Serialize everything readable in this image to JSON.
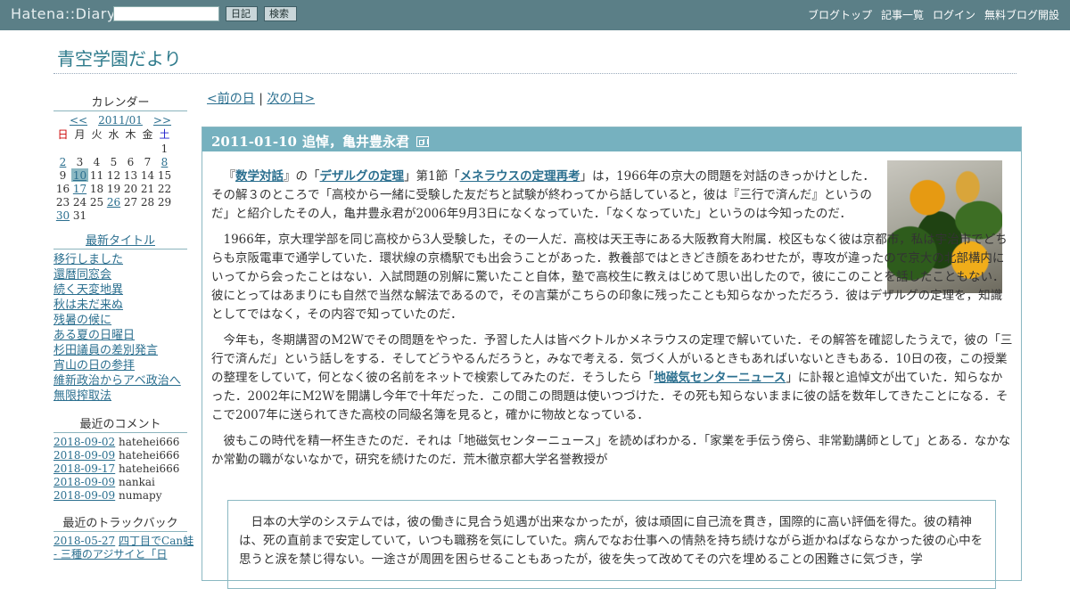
{
  "topbar": {
    "logo": "Hatena::Diary",
    "search_placeholder": "",
    "diary_button": "日記",
    "search_button": "検索",
    "links": [
      "ブログトップ",
      "記事一覧",
      "ログイン",
      "無料ブログ開設"
    ]
  },
  "blog": {
    "title": "青空学園だより"
  },
  "sidebar": {
    "calendar_title": "カレンダー",
    "cal_prev": "<<",
    "cal_month": "2011/01",
    "cal_next": ">>",
    "weekdays": [
      "日",
      "月",
      "火",
      "水",
      "木",
      "金",
      "土"
    ],
    "weeks": [
      [
        "",
        "",
        "",
        "",
        "",
        "",
        "1"
      ],
      [
        "2",
        "3",
        "4",
        "5",
        "6",
        "7",
        "8"
      ],
      [
        "9",
        "10",
        "11",
        "12",
        "13",
        "14",
        "15"
      ],
      [
        "16",
        "17",
        "18",
        "19",
        "20",
        "21",
        "22"
      ],
      [
        "23",
        "24",
        "25",
        "26",
        "27",
        "28",
        "29"
      ],
      [
        "30",
        "31",
        "",
        "",
        "",
        "",
        ""
      ]
    ],
    "linked_days": [
      "2",
      "8",
      "10",
      "17",
      "26",
      "30"
    ],
    "today": "10",
    "recent_titles_heading": "最新タイトル",
    "recent_titles": [
      "移行しました",
      "還暦同窓会",
      "続く天変地異",
      "秋は未だ来ぬ",
      "残暑の候に",
      "ある夏の日曜日",
      "杉田議員の差別発言",
      "宵山の日の参拝",
      "維新政治からアベ政治へ",
      "無限搾取法"
    ],
    "recent_comments_heading": "最近のコメント",
    "recent_comments": [
      {
        "date": "2018-09-02",
        "user": "hatehei666"
      },
      {
        "date": "2018-09-09",
        "user": "hatehei666"
      },
      {
        "date": "2018-09-17",
        "user": "hatehei666"
      },
      {
        "date": "2018-09-09",
        "user": "nankai"
      },
      {
        "date": "2018-09-09",
        "user": "numapy"
      }
    ],
    "recent_trackbacks_heading": "最近のトラックバック",
    "recent_trackbacks": [
      {
        "date": "2018-05-27",
        "title": "四丁目でCan蛙"
      },
      {
        "date": "",
        "title": "- 三種のアジサイと「日"
      }
    ]
  },
  "main": {
    "prev_day": "<前の日",
    "separator": "|",
    "next_day": "次の日>",
    "entry": {
      "date": "2011-01-10",
      "title": "追悼，亀井豊永君",
      "p1": [
        "『",
        "数学対話",
        "』の「",
        "デザルグの定理",
        "」第1節「",
        "メネラウスの定理再考",
        "」は，1966年の京大の問題を対話のきっかけとした．その解３のところで「高校から一緒に受験した友だちと試験が終わってから話していると，彼は『三行で済んだ』というのだ」と紹介したその人，亀井豊永君が2006年9月3日になくなっていた．「なくなっていた」というのは今知ったのだ．"
      ],
      "p2": "1966年，京大理学部を同じ高校から3人受験した，その一人だ．高校は天王寺にある大阪教育大附属．校区もなく彼は京都市，私は宇治市でどちらも京阪電車で通学していた．環状線の京橋駅でも出会うことがあった．教養部ではときどき顔をあわせたが，専攻が違ったので京大の北部構内にいってから会ったことはない．入試問題の別解に驚いたこと自体，塾で高校生に教えはじめて思い出したので，彼にこのことを話したこともない．彼にとってはあまりにも自然で当然な解法であるので，その言葉がこちらの印象に残ったことも知らなかっただろう．彼はデザルグの定理を，知識としてではなく，その内容で知っていたのだ．",
      "p3": [
        "今年も，冬期講習のM2Wでその問題をやった．予習した人は皆ベクトルかメネラウスの定理で解いていた．その解答を確認したうえで，彼の「三行で済んだ」という話しをする．そしてどうやるんだろうと，みなで考える．気づく人がいるときもあればいないときもある．10日の夜，この授業の整理をしていて，何となく彼の名前をネットで検索してみたのだ．そうしたら「",
        "地磁気センターニュース",
        "」に訃報と追悼文が出ていた．知らなかった．2002年にM2Wを開講し今年で十年だった．この間この問題は使いつづけた．その死も知らないままに彼の話を数年してきたことになる．そこで2007年に送られてきた高校の同級名簿を見ると，確かに物故となっている．"
      ],
      "p4": "彼もこの時代を精一杯生きたのだ．それは「地磁気センターニュース」を読めばわかる．「家業を手伝う傍ら、非常勤講師として」とある．なかなか常勤の職がないなかで，研究を続けたのだ．荒木徹京都大学名誉教授が",
      "quote": "日本の大学のシステムでは，彼の働きに見合う処遇が出来なかったが，彼は頑固に自己流を貫き，国際的に高い評価を得た。彼の精神は、死の直前まで安定していて，いつも職務を気にしていた。病んでなお仕事への情熱を持ち続けながら逝かねばならなかった彼の心中を思うと涙を禁じ得ない。一途さが周囲を困らせることもあったが，彼を失って改めてその穴を埋めることの困難さに気づき，学"
    }
  }
}
